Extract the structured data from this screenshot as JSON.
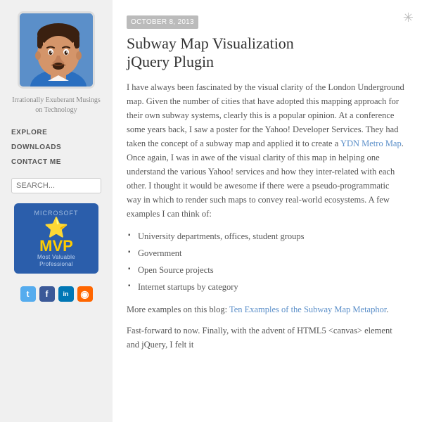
{
  "sidebar": {
    "tagline": "Irrationally Exuberant Musings on Technology",
    "nav_items": [
      {
        "label": "EXPLORE",
        "href": "#"
      },
      {
        "label": "DOWNLOADS",
        "href": "#"
      },
      {
        "label": "CONTACT ME",
        "href": "#"
      }
    ],
    "search_placeholder": "SEARCH...",
    "mvp_badge": {
      "top_text": "Microsoft",
      "main_text": "MVP",
      "subtitle": "Most Valuable\nProfessional"
    },
    "social_icons": [
      {
        "name": "twitter",
        "label": "t",
        "class": "social-twitter"
      },
      {
        "name": "facebook",
        "label": "f",
        "class": "social-facebook"
      },
      {
        "name": "linkedin",
        "label": "in",
        "class": "social-linkedin"
      },
      {
        "name": "rss",
        "label": "✦",
        "class": "social-rss"
      }
    ]
  },
  "post": {
    "date": "OCTOBER 8, 2013",
    "title_line1": "Subway Map Visualization",
    "title_line2": "jQuery Plugin",
    "body_p1": "I have always been fascinated by the visual clarity of the London Underground map. Given the number of cities that have adopted this mapping approach for their own subway systems, clearly this is a popular opinion. At a conference some years back, I saw a poster for the Yahoo! Developer Services. They had taken the concept of a subway map and applied it to create a YDN Metro Map. Once again, I was in awe of the visual clarity of this map in helping one understand the various Yahoo! services and how they inter-related with each other. I thought it would be awesome if there were a pseudo-programmatic way in which to render such maps to convey real-world ecosystems. A few examples I can think of:",
    "ydnlink_text": "YDN Metro Map",
    "list_items": [
      "University departments, offices, student groups",
      "Government",
      "Open Source projects",
      "Internet startups by category"
    ],
    "body_p2_prefix": "More examples on this blog: ",
    "body_p2_link": "Ten Examples of the Subway Map Metaphor",
    "body_p2_suffix": ".",
    "body_p3": "Fast-forward to now. Finally, with the advent of HTML5 <canvas> element and jQuery, I felt it"
  },
  "corner": {
    "symbol": "✳"
  }
}
